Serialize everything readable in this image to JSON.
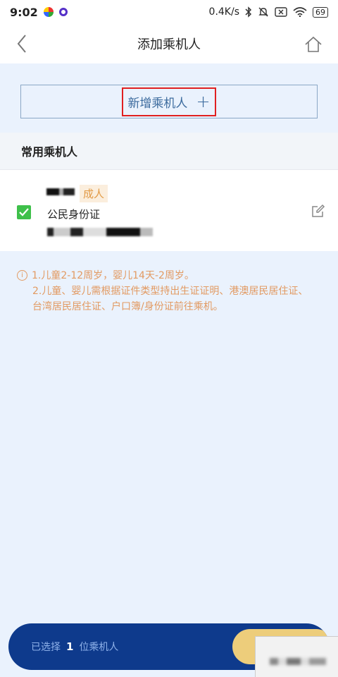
{
  "status_bar": {
    "time": "9:02",
    "network_speed": "0.4K/s",
    "battery": "69"
  },
  "nav": {
    "title": "添加乘机人",
    "back_icon": "chevron-left-icon",
    "home_icon": "home-icon"
  },
  "add_passenger": {
    "label": "新增乘机人",
    "plus": "+"
  },
  "section": {
    "title": "常用乘机人"
  },
  "passenger": {
    "type_badge": "成人",
    "id_type": "公民身份证",
    "selected": true
  },
  "notes": {
    "line1": "1.儿童2-12周岁，婴儿14天-2周岁。",
    "line2": "2.儿童、婴儿需根据证件类型持出生证证明、港澳居民居住证、",
    "line3": "台湾居民居住证、户口簿/身份证前往乘机。"
  },
  "bottom_bar": {
    "prefix": "已选择",
    "count": "1",
    "suffix": "位乘机人"
  },
  "colors": {
    "accent_blue": "#0e3a8c",
    "note_orange": "#e29a62",
    "check_green": "#3ec04a",
    "confirm_gold": "#edcd7b"
  }
}
